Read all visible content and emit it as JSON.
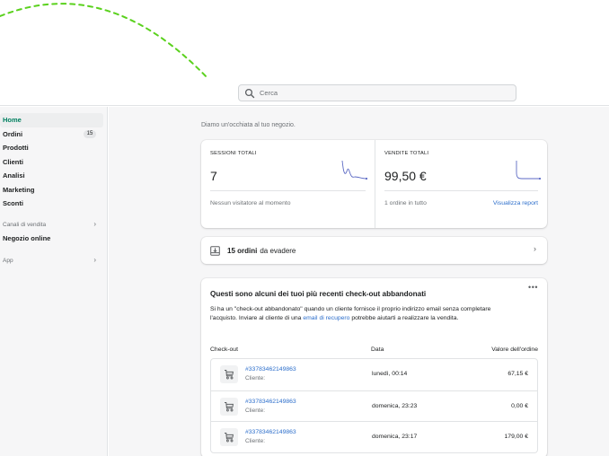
{
  "search": {
    "placeholder": "Cerca"
  },
  "sidebar": {
    "items": [
      {
        "label": "Home",
        "active": true
      },
      {
        "label": "Ordini",
        "badge": "15"
      },
      {
        "label": "Prodotti"
      },
      {
        "label": "Clienti"
      },
      {
        "label": "Analisi"
      },
      {
        "label": "Marketing"
      },
      {
        "label": "Sconti"
      }
    ],
    "sales_channels_label": "Canali di vendita",
    "online_store_label": "Negozio online",
    "apps_label": "App"
  },
  "main": {
    "greeting": "Diamo un'occhiata al tuo negozio.",
    "stats": {
      "sessions": {
        "label": "SESSIONI TOTALI",
        "value": "7",
        "footer": "Nessun visitatore al momento"
      },
      "sales": {
        "label": "VENDITE TOTALI",
        "value": "99,50 €",
        "footer": "1 ordine in tutto",
        "link": "Visualizza report"
      }
    },
    "orders_to_fulfill": {
      "count_label": "15 ordini",
      "rest_label": "da evadere"
    },
    "abandoned": {
      "title": "Questi sono alcuni dei tuoi più recenti check-out abbandonati",
      "desc_before": "Si ha un \"check-out abbandonato\" quando un cliente fornisce il proprio indirizzo email senza completare l'acquisto. Inviare al cliente di una ",
      "desc_link": "email di recupero",
      "desc_after": " potrebbe aiutarti a realizzare la vendita.",
      "more": "•••",
      "columns": [
        "Check-out",
        "Data",
        "Valore dell'ordine"
      ],
      "rows": [
        {
          "id": "#33783462149863",
          "client": "Cliente:",
          "date": "lunedì, 00:14",
          "value": "67,15 €"
        },
        {
          "id": "#33783462149863",
          "client": "Cliente:",
          "date": "domenica, 23:23",
          "value": "0,00 €"
        },
        {
          "id": "#33783462149863",
          "client": "Cliente:",
          "date": "domenica, 23:17",
          "value": "179,00 €"
        }
      ]
    }
  },
  "colors": {
    "accent_green": "#008060",
    "link_blue": "#2c6ecb",
    "spark_blue": "#5c6ac4",
    "decor_green": "#5ad11d"
  }
}
